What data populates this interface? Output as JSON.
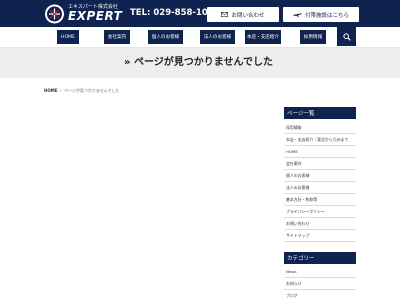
{
  "header": {
    "company_sub": "エキスパート株式会社",
    "logo_text": "EXPERT",
    "tel": "TEL: 029-858-1000",
    "contact_button": "お問い合わせ",
    "school_button": "付帯施設はこちら"
  },
  "nav": {
    "items": [
      {
        "label": "HOME"
      },
      {
        "label": "会社案内"
      },
      {
        "label": "個人のお客様"
      },
      {
        "label": "法人のお客様"
      },
      {
        "label": "本店・支店紹介"
      },
      {
        "label": "採用情報"
      }
    ],
    "search_icon": "search-icon"
  },
  "banner": {
    "title": "» ページが見つかりませんでした"
  },
  "breadcrumb": {
    "home": "HOME",
    "separator": "»",
    "current": "ページが見つかりませんでした"
  },
  "sidebar": {
    "pages_title": "ページ一覧",
    "pages": [
      "採用情報",
      "本店・支店紹介｜東北から九州まで",
      "HOME",
      "会社案内",
      "個人のお客様",
      "法人のお客様",
      "基本方針・約款等",
      "プライバシーポリシー",
      "お問い合わせ",
      "サイトマップ"
    ],
    "category_title": "カテゴリー",
    "categories": [
      "News",
      "お知らせ",
      "ブログ"
    ]
  },
  "colors": {
    "brand_navy": "#0f2350",
    "banner_gray": "#eeeeee"
  }
}
